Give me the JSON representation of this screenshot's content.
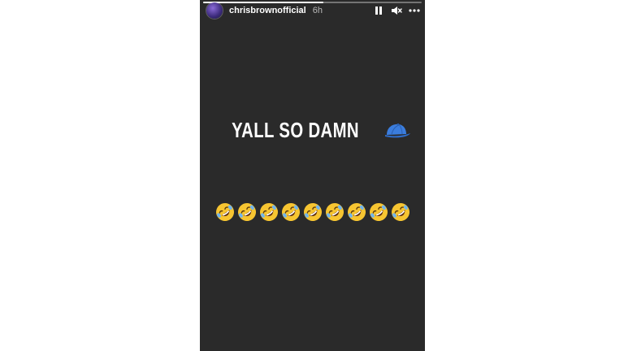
{
  "header": {
    "username": "chrisbrownofficial",
    "timestamp": "6h"
  },
  "icons": {
    "pause": "pause-icon",
    "mute": "mute-icon",
    "more": "more-icon",
    "cap": "blue-cap-emoji",
    "laughing": "rolling-on-floor-laughing-emoji"
  },
  "story": {
    "headline": "YALL SO DAMN",
    "laughing_emoji_count": 9,
    "progress": 0.55
  },
  "colors": {
    "background": "#2a2a2a",
    "text": "#ffffff",
    "cap": "#3b7ddd",
    "emoji_face": "#f7c531"
  }
}
